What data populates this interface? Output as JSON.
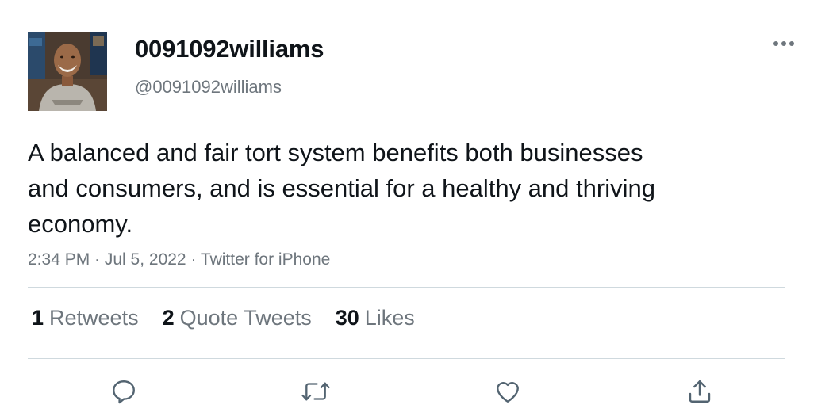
{
  "user": {
    "display_name": "0091092williams",
    "handle": "@0091092williams",
    "avatar_icon": "profile-photo"
  },
  "tweet": {
    "text": "A balanced and fair tort system benefits both businesses and consumers, and is essential for a healthy and thriving economy.",
    "meta": "2:34 PM · Jul 5, 2022 · Twitter for iPhone"
  },
  "stats": {
    "retweets_count": "1",
    "retweets_label": "Retweets",
    "quotes_count": "2",
    "quotes_label": "Quote Tweets",
    "likes_count": "30",
    "likes_label": "Likes"
  },
  "actions": [
    "reply-icon",
    "retweet-icon",
    "like-icon",
    "share-icon"
  ],
  "colors": {
    "primary_text": "#0f1419",
    "secondary_text": "#6e767d",
    "divider": "#cfd9de"
  }
}
